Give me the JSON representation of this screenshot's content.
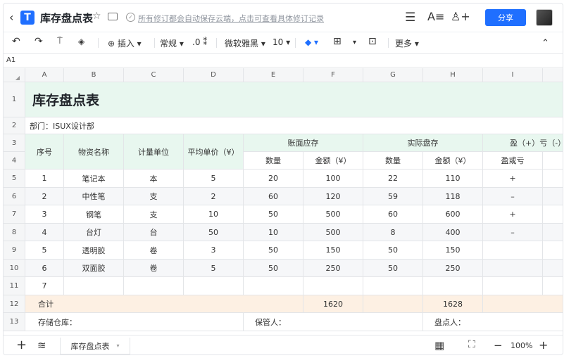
{
  "header": {
    "back_icon": "‹",
    "logo_text": "T",
    "title": "库存盘点表",
    "star_icon": "☆",
    "save_status": "所有修订都会自动保存云端，点击可查看具体修订记录",
    "menu_icon": "☰",
    "font_icon": "A≡",
    "add_user_icon": "♙+",
    "share_label": "分享"
  },
  "toolbar": {
    "undo": "↶",
    "redo": "↷",
    "format_painter": "⍑",
    "eraser": "◈",
    "insert_label": "⊕ 插入 ▾",
    "number_format": "常规 ▾",
    "decimal": ".0 ⁑",
    "font_family": "微软雅黑 ▾",
    "font_size": "10 ▾",
    "fill_icon": "◆ ▾",
    "border_icon": "⊞",
    "border_caret": "▾",
    "merge_icon": "⊡",
    "more_label": "更多 ▾",
    "collapse_icon": "⌃"
  },
  "formula_bar": {
    "cell_ref": "A1"
  },
  "columns": [
    "A",
    "B",
    "C",
    "D",
    "E",
    "F",
    "G",
    "H",
    "I"
  ],
  "rows": [
    "1",
    "2",
    "3",
    "4",
    "5",
    "6",
    "7",
    "8",
    "9",
    "10",
    "11",
    "12",
    "13"
  ],
  "sheet": {
    "title": "库存盘点表",
    "dept": "部门：ISUX设计部",
    "h_seq": "序号",
    "h_name": "物资名称",
    "h_unit": "计量单位",
    "h_price": "平均单价（¥）",
    "h_book": "账面应存",
    "h_actual": "实际盘存",
    "h_pl": "盈（+）亏（-）情",
    "h_qty": "数量",
    "h_amt": "金额（¥）",
    "h_qty2": "数量",
    "h_amt2": "金额（¥）",
    "h_plsub": "盈或亏",
    "items": [
      {
        "seq": "1",
        "name": "笔记本",
        "unit": "本",
        "price": "5",
        "bq": "20",
        "ba": "100",
        "aq": "22",
        "aa": "110",
        "pl": "+"
      },
      {
        "seq": "2",
        "name": "中性笔",
        "unit": "支",
        "price": "2",
        "bq": "60",
        "ba": "120",
        "aq": "59",
        "aa": "118",
        "pl": "–"
      },
      {
        "seq": "3",
        "name": "钢笔",
        "unit": "支",
        "price": "10",
        "bq": "50",
        "ba": "500",
        "aq": "60",
        "aa": "600",
        "pl": "+"
      },
      {
        "seq": "4",
        "name": "台灯",
        "unit": "台",
        "price": "50",
        "bq": "10",
        "ba": "500",
        "aq": "8",
        "aa": "400",
        "pl": "–"
      },
      {
        "seq": "5",
        "name": "透明胶",
        "unit": "卷",
        "price": "3",
        "bq": "50",
        "ba": "150",
        "aq": "50",
        "aa": "150",
        "pl": ""
      },
      {
        "seq": "6",
        "name": "双面胶",
        "unit": "卷",
        "price": "5",
        "bq": "50",
        "ba": "250",
        "aq": "50",
        "aa": "250",
        "pl": ""
      },
      {
        "seq": "7",
        "name": "",
        "unit": "",
        "price": "",
        "bq": "",
        "ba": "",
        "aq": "",
        "aa": "",
        "pl": ""
      }
    ],
    "total_label": "合计",
    "total_book": "1620",
    "total_actual": "1628",
    "warehouse": "存储仓库：",
    "keeper": "保管人：",
    "counter": "盘点人："
  },
  "bottom": {
    "add_icon": "+",
    "layers_icon": "≋",
    "sheet_tab": "库存盘点表",
    "sheet_caret": "▾",
    "grid_icon": "▦",
    "fullscreen_icon": "⛶",
    "zoom_out": "−",
    "zoom": "100%",
    "zoom_in": "+"
  },
  "colors": {
    "accent": "#1f6fff",
    "header_fill": "#e8f7ef",
    "total_fill": "#fdf0e3"
  }
}
